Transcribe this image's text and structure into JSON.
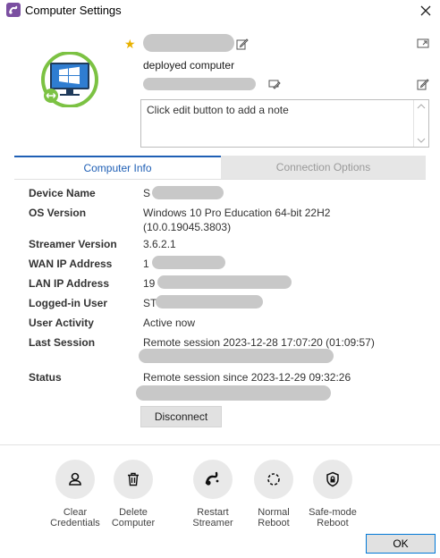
{
  "window": {
    "title": "Computer Settings"
  },
  "header": {
    "description": "deployed computer",
    "note_placeholder": "Click edit button to add a note"
  },
  "tabs": [
    {
      "label": "Computer Info",
      "active": true
    },
    {
      "label": "Connection Options",
      "active": false
    }
  ],
  "info": {
    "device_name": {
      "label": "Device Name",
      "value": "S"
    },
    "os_version": {
      "label": "OS Version",
      "value": "Windows 10 Pro Education 64-bit 22H2",
      "value2": "(10.0.19045.3803)"
    },
    "streamer_version": {
      "label": "Streamer Version",
      "value": "3.6.2.1"
    },
    "wan_ip": {
      "label": "WAN IP Address",
      "value": "1"
    },
    "lan_ip": {
      "label": "LAN IP Address",
      "value": "19"
    },
    "logged_in_user": {
      "label": "Logged-in User",
      "value": "ST"
    },
    "user_activity": {
      "label": "User Activity",
      "value": "Active now"
    },
    "last_session": {
      "label": "Last Session",
      "value": "Remote session 2023-12-28 17:07:20 (01:09:57)"
    },
    "status": {
      "label": "Status",
      "value": "Remote session since 2023-12-29 09:32:26"
    }
  },
  "buttons": {
    "disconnect": "Disconnect",
    "ok": "OK"
  },
  "actions": [
    {
      "label": "Clear\nCredentials",
      "icon": "user-icon"
    },
    {
      "label": "Delete\nComputer",
      "icon": "trash-icon"
    },
    {
      "label": "Restart\nStreamer",
      "icon": "splashtop-icon"
    },
    {
      "label": "Normal\nReboot",
      "icon": "reboot-icon"
    },
    {
      "label": "Safe-mode\nReboot",
      "icon": "shield-lock-icon"
    }
  ],
  "colors": {
    "accent": "#1f5fb5",
    "monitor_ring": "#7cc243",
    "brand": "#7b4fa1"
  }
}
